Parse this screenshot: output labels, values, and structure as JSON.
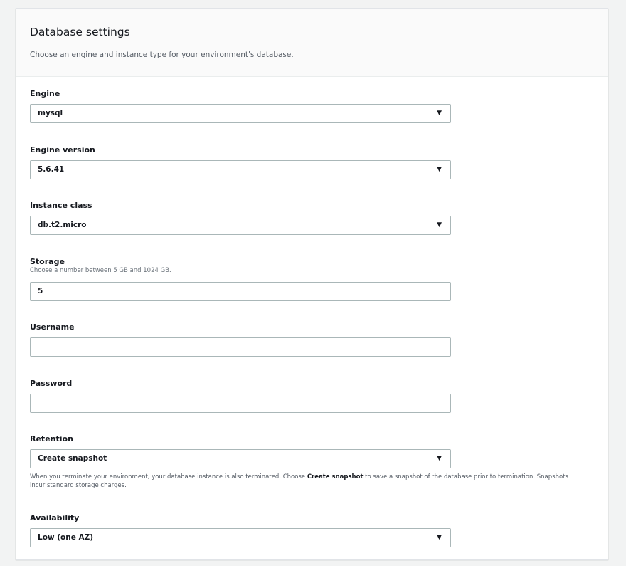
{
  "section": {
    "title": "Database settings",
    "description": "Choose an engine and instance type for your environment's database."
  },
  "fields": {
    "engine": {
      "label": "Engine",
      "value": "mysql"
    },
    "engine_version": {
      "label": "Engine version",
      "value": "5.6.41"
    },
    "instance_class": {
      "label": "Instance class",
      "value": "db.t2.micro"
    },
    "storage": {
      "label": "Storage",
      "hint": "Choose a number between 5 GB and 1024 GB.",
      "value": "5"
    },
    "username": {
      "label": "Username",
      "value": ""
    },
    "password": {
      "label": "Password",
      "value": ""
    },
    "retention": {
      "label": "Retention",
      "value": "Create snapshot",
      "help_before": "When you terminate your environment, your database instance is also terminated. Choose ",
      "help_bold": "Create snapshot",
      "help_after": " to save a snapshot of the database prior to termination. Snapshots incur standard storage charges."
    },
    "availability": {
      "label": "Availability",
      "value": "Low (one AZ)"
    }
  },
  "icons": {
    "dropdown": "caret-down-icon"
  }
}
